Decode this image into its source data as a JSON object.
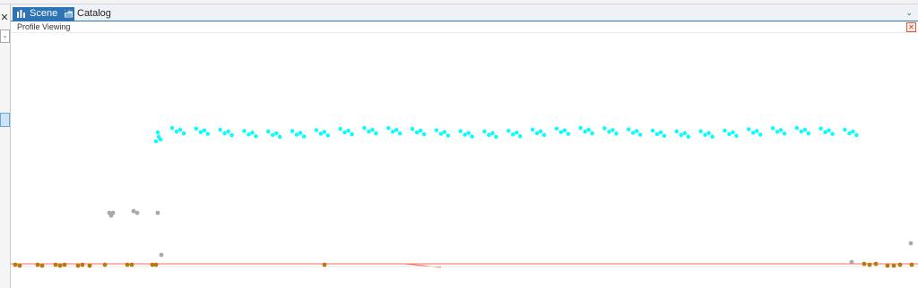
{
  "tabs": [
    {
      "label": "Scene",
      "icon": "scene-icon",
      "active": true
    },
    {
      "label": "Catalog",
      "icon": "catalog-icon",
      "active": false
    }
  ],
  "view": {
    "title": "Profile Viewing"
  },
  "colors": {
    "accent": "#2e74b5",
    "building_points": "#00ffff",
    "unclassified_points": "#a9a9a9",
    "ground_points": "#b8780a",
    "ground_line": "#ff6a5a"
  }
}
